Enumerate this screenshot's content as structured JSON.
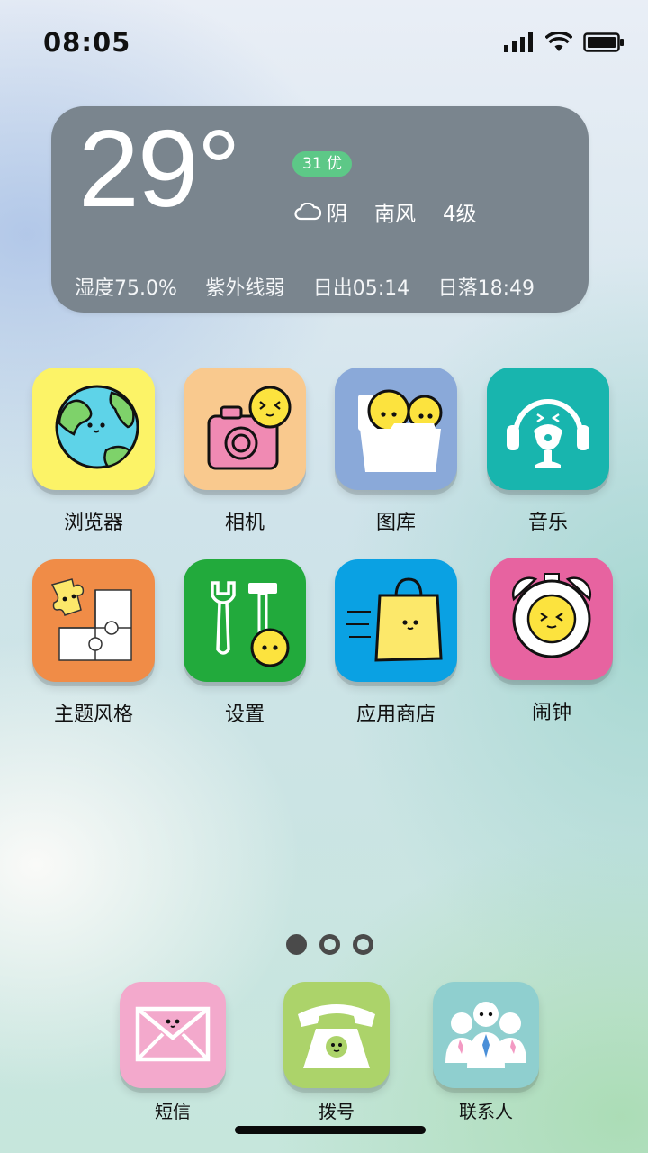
{
  "status_bar": {
    "time": "08:05"
  },
  "weather": {
    "temperature": "29°",
    "aqi": "31 优",
    "condition": "阴",
    "wind_direction": "南风",
    "wind_level": "4级",
    "humidity": "湿度75.0%",
    "uv": "紫外线弱",
    "sunrise": "日出05:14",
    "sunset": "日落18:49",
    "colors": {
      "card": "#7a858e",
      "aqi_badge": "#5dc887"
    }
  },
  "apps": [
    {
      "label": "浏览器",
      "icon": "globe-icon",
      "color": "#fcf367"
    },
    {
      "label": "相机",
      "icon": "camera-icon",
      "color": "#f9c98e"
    },
    {
      "label": "图库",
      "icon": "folder-icon",
      "color": "#8aa9d9"
    },
    {
      "label": "音乐",
      "icon": "headphones-icon",
      "color": "#18b5ae"
    },
    {
      "label": "主题风格",
      "icon": "puzzle-icon",
      "color": "#f08c47"
    },
    {
      "label": "设置",
      "icon": "tools-icon",
      "color": "#22aa3c"
    },
    {
      "label": "应用商店",
      "icon": "shopping-bag-icon",
      "color": "#0aa1e3"
    },
    {
      "label": "闹钟",
      "icon": "alarm-clock-icon",
      "color": "#e763a0"
    }
  ],
  "pager": {
    "pages": 3,
    "current": 1
  },
  "dock": [
    {
      "label": "短信",
      "icon": "envelope-icon",
      "color": "#f3a9cc"
    },
    {
      "label": "拨号",
      "icon": "telephone-icon",
      "color": "#acd36a"
    },
    {
      "label": "联系人",
      "icon": "contacts-icon",
      "color": "#8fcfcf"
    }
  ]
}
